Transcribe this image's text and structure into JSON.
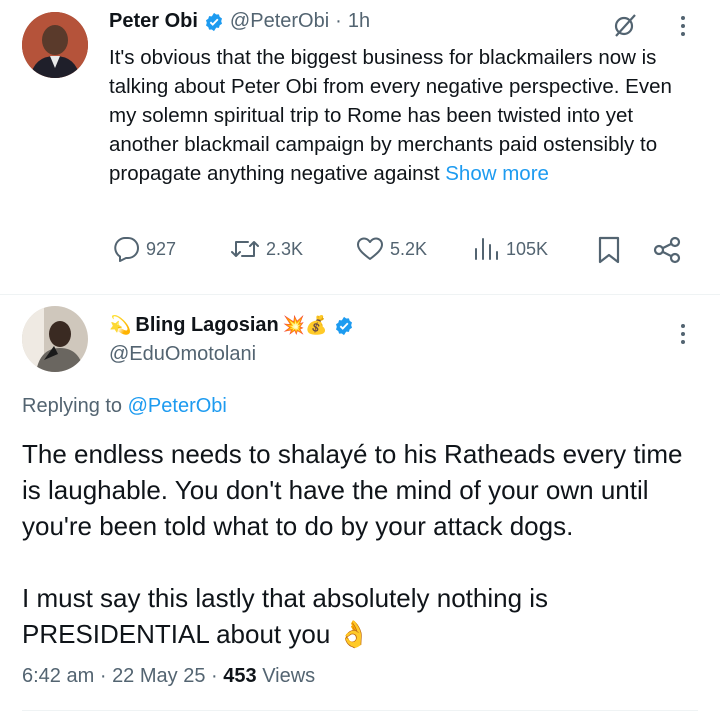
{
  "original_tweet": {
    "author_name": "Peter Obi",
    "handle": "@PeterObi",
    "separator": "·",
    "time": "1h",
    "text": "It's obvious that the biggest business for blackmailers now is talking about Peter Obi from every negative perspective. Even my solemn spiritual trip to Rome has been twisted into yet another blackmail campaign by merchants paid ostensibly to propagate anything negative against",
    "show_more": "Show more",
    "stats": {
      "replies": "927",
      "reposts": "2.3K",
      "likes": "5.2K",
      "views": "105K"
    }
  },
  "reply": {
    "author_prefix_emoji": "💫",
    "author_name": "Bling Lagosian",
    "author_suffix_emoji": "💥💰",
    "handle": "@EduOmotolani",
    "replying_label": "Replying to",
    "replying_handle": "@PeterObi",
    "paragraph_1": "The endless needs to shalayé to his Ratheads every time is laughable. You don't have the mind of your own until you're been told what to do by your attack dogs.",
    "paragraph_2": "I must say this lastly that absolutely nothing is PRESIDENTIAL about you",
    "paragraph_2_emoji": "👌",
    "time": "6:42 am",
    "sep1": "·",
    "date": "22 May 25",
    "sep2": "·",
    "views_count": "453",
    "views_label": "Views"
  },
  "colors": {
    "accent": "#1d9bf0",
    "secondary_text": "#536471",
    "primary_text": "#0f1419",
    "verified": "#1d9bf0"
  }
}
